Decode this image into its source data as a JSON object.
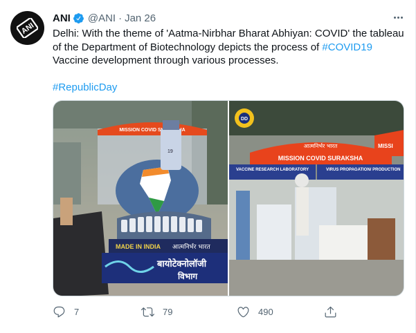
{
  "tweet": {
    "author_name": "ANI",
    "handle": "@ANI",
    "separator": "·",
    "date": "Jan 26",
    "text_line1_before": "Delhi: With the theme of 'Aatma-Nirbhar Bharat Abhiyan: COVID' the tableau of the Department of Biotechnology depicts the process of ",
    "text_hashtag1": "#COVID19",
    "text_line1_after": " Vaccine development through various processes.",
    "hashtag2": "#RepublicDay",
    "avatar_text": "ANI"
  },
  "media": {
    "image1": {
      "banner": "MISSION COVID SURAKSHA",
      "vial_label": "19",
      "made_in": "MADE IN INDIA",
      "hindi_top": "आत्मनिर्भर भारत",
      "hindi_bottom_1": "बायोटेक्नोलॉजी",
      "hindi_bottom_2": "विभाग"
    },
    "image2": {
      "hindi_banner": "आत्मनिर्भर भारत",
      "banner": "MISSION COVID SURAKSHA",
      "banner_right": "MISSI",
      "label_left": "VACCINE RESEARCH LABORATORY",
      "label_right": "VIRUS PROPAGATION/ PRODUCTION",
      "dd_logo": "DD"
    }
  },
  "actions": {
    "reply_count": "7",
    "retweet_count": "79",
    "like_count": "490"
  },
  "colors": {
    "accent": "#1d9bf0",
    "secondary_text": "#536471",
    "verified": "#1d9bf0"
  },
  "icons": {
    "verified": "verified-badge-icon",
    "more": "more-dots-icon",
    "reply": "reply-icon",
    "retweet": "retweet-icon",
    "like": "heart-icon",
    "share": "share-icon"
  }
}
